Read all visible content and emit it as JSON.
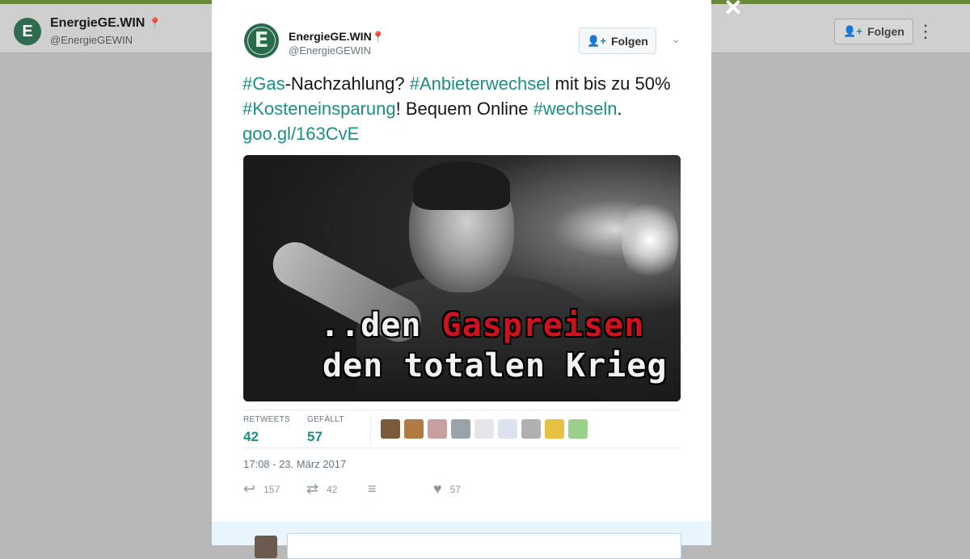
{
  "background": {
    "profile_name": "EnergieGE.WIN",
    "profile_handle": "@EnergieGEWIN",
    "follow_label": "Folgen",
    "avatar_letter": "E",
    "more_icon": "more-vertical-icon"
  },
  "modal": {
    "close_icon": "close-icon",
    "author": {
      "avatar_letter": "E",
      "name": "EnergieGE.WIN",
      "pin": "📍",
      "handle": "@EnergieGEWIN"
    },
    "follow_label": "Folgen",
    "caret_icon": "chevron-down-icon",
    "tweet": {
      "tag_gas": "#Gas",
      "text_1": "-Nachzahlung? ",
      "tag_anbieter": "#Anbieterwechsel",
      "text_2": " mit bis zu 50% ",
      "tag_kosten": "#Kosteneinsparung",
      "text_3": "! Bequem Online ",
      "tag_wechseln": "#wechseln",
      "text_4": ". ",
      "link": "goo.gl/163CvE"
    },
    "photo": {
      "caption_prefix": "..den ",
      "caption_red": "Gaspreisen",
      "caption_line2": "den totalen Krieg"
    },
    "stats": {
      "retweets_label": "RETWEETS",
      "retweets_value": "42",
      "likes_label": "GEFÄLLT",
      "likes_value": "57"
    },
    "liker_faces": [
      {
        "color": "#7a5a3a"
      },
      {
        "color": "#b07a40"
      },
      {
        "color": "#c9a0a0"
      },
      {
        "color": "#9aa3aa"
      },
      {
        "color": "#e6e6ea"
      },
      {
        "color": "#dde3ee"
      },
      {
        "color": "#b0b0b0"
      },
      {
        "color": "#e8c040"
      },
      {
        "color": "#9ad08a"
      }
    ],
    "timestamp": "17:08 - 23. März 2017",
    "actions": {
      "reply_count": "157",
      "retweet_count": "42",
      "like_count": "57"
    }
  }
}
